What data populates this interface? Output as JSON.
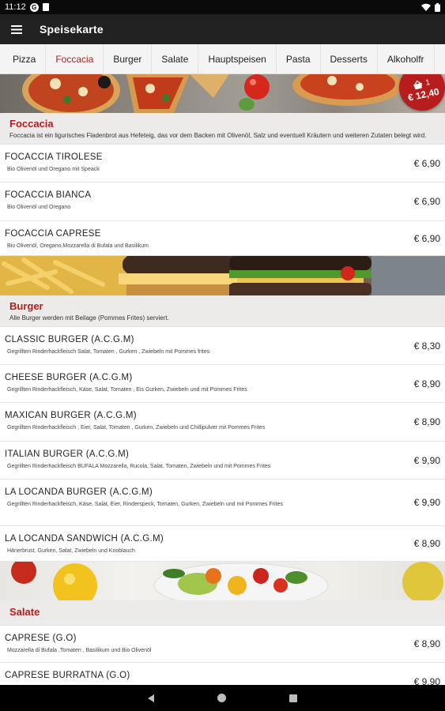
{
  "status_bar": {
    "time": "11:12",
    "g_glyph": "G"
  },
  "app_bar": {
    "title": "Speisekarte"
  },
  "tabs": [
    {
      "label": "Pizza"
    },
    {
      "label": "Foccacia"
    },
    {
      "label": "Burger"
    },
    {
      "label": "Salate"
    },
    {
      "label": "Hauptspeisen"
    },
    {
      "label": "Pasta"
    },
    {
      "label": "Desserts"
    },
    {
      "label": "Alkoholfr"
    }
  ],
  "active_tab": "Foccacia",
  "cart": {
    "count": "1",
    "total": "€ 12,40"
  },
  "foccacia": {
    "title": "Foccacia",
    "description": "Foccacia ist ein ligurisches Fladenbrot aus Hefeteig, das vor dem Backen mit Olivenöl, Salz und eventuell Kräutern und weiteren Zutaten belegt wird.",
    "items": [
      {
        "name": "FOCACCIA TIROLESE",
        "desc": "Bio Olivenöl und Oregano mit Speack",
        "price": "€ 6,90"
      },
      {
        "name": "FOCACCIA BIANCA",
        "desc": "Bio Olivenöl und Oregano",
        "price": "€ 6,90"
      },
      {
        "name": "FOCACCIA CAPRESE",
        "desc": "Bio Olivenöl, Oregano,Mozzarella di Bufala und Basilikum",
        "price": "€ 6,90"
      }
    ]
  },
  "burger": {
    "title": "Burger",
    "description": "Alle Burger werden mit Beilage (Pommes Frites) serviert.",
    "items": [
      {
        "name": "CLASSIC BURGER (A.C.G.M)",
        "desc": "Gegrillten Rinderhackfleisch Salat, Tomaten , Gurken , Zwiebeln mit Pommes frites",
        "price": "€ 8,30"
      },
      {
        "name": "CHEESE BURGER (A.C.G.M)",
        "desc": "Gegrillten Rinderhackfleisch, Käse, Salat, Tomaten , Eis Gurken, Zwiebeln und mit Pommes Frites",
        "price": "€ 8,90"
      },
      {
        "name": "MAXICAN BURGER (A.C.G.M)",
        "desc": "Gegrillten Rinderhackfleisch , Eier, Salat, Tomaten , Gurken, Zwiebeln  und Chillipulver mit Pommes Frites",
        "price": "€ 8,90"
      },
      {
        "name": "ITALIAN BURGER (A.C.G.M)",
        "desc": "Gegrillten Rinderhackfleisch BUFALA Mozzarella, Rucola, Salat, Tomaten, Zwiebeln und mit Pommes Frites",
        "price": "€ 9,90"
      },
      {
        "name": "LA LOCANDA BURGER (A.C.G.M)",
        "desc": "Gegrillten Rinderhackfleisch, Käse, Salat, Eier, Rinderspeck, Tomaten, Gurken, Zwiebeln und mit Pommes Frites",
        "price": "€ 9,90"
      },
      {
        "name": "LA LOCANDA SANDWICH (A.C.G.M)",
        "desc": "Hänerbrust, Gurken, Salat, Zwiebeln und Knoblauch",
        "price": "€ 8,90"
      }
    ]
  },
  "salate": {
    "title": "Salate",
    "description": "",
    "items": [
      {
        "name": "CAPRESE (G.O)",
        "desc": "Mozzarella di Bufala ,Tomaten , Basilikum und Bio Olivenöl",
        "price": "€ 8,90"
      },
      {
        "name": "CAPRESE BURRATNA (G.O)",
        "desc": "",
        "price": "€ 9,90"
      }
    ]
  }
}
